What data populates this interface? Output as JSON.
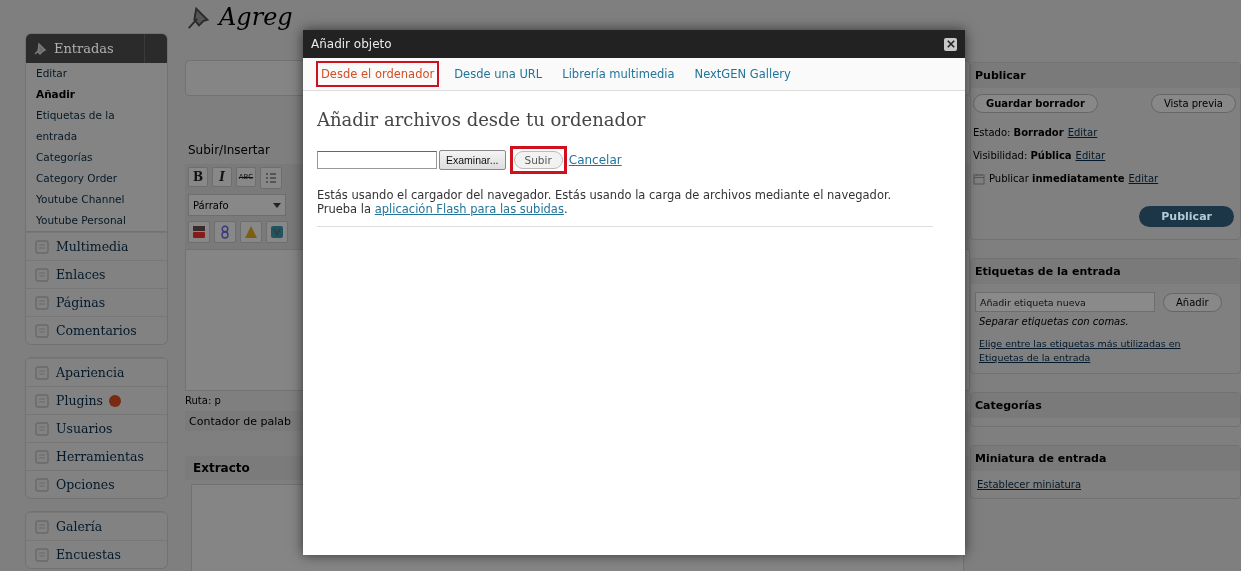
{
  "sidebar": {
    "groups": [
      [
        {
          "label": "Entradas",
          "expanded": true,
          "children": [
            {
              "label": "Editar",
              "selected": false
            },
            {
              "label": "Añadir",
              "selected": true
            },
            {
              "label": "Etiquetas de la entrada",
              "selected": false
            },
            {
              "label": "Categorías",
              "selected": false
            },
            {
              "label": "Category Order",
              "selected": false
            },
            {
              "label": "Youtube Channel",
              "selected": false
            },
            {
              "label": "Youtube Personal",
              "selected": false
            }
          ]
        },
        {
          "label": "Multimedia",
          "expanded": false
        },
        {
          "label": "Enlaces",
          "expanded": false
        },
        {
          "label": "Páginas",
          "expanded": false
        },
        {
          "label": "Comentarios",
          "expanded": false
        }
      ],
      [
        {
          "label": "Apariencia",
          "expanded": false
        },
        {
          "label": "Plugins",
          "expanded": false,
          "badge": true
        },
        {
          "label": "Usuarios",
          "expanded": false
        },
        {
          "label": "Herramientas",
          "expanded": false
        },
        {
          "label": "Opciones",
          "expanded": false
        }
      ],
      [
        {
          "label": "Galería",
          "expanded": false
        },
        {
          "label": "Encuestas",
          "expanded": false
        }
      ]
    ]
  },
  "editor": {
    "title": "Agreg",
    "upload_label": "Subir/Insertar",
    "toolbar": [
      "B",
      "I",
      "ABC"
    ],
    "format": "Párrafo",
    "path": "Ruta: p",
    "word_count": "Contador de palab",
    "excerpt_title": "Extracto"
  },
  "publish": {
    "title": "Publicar",
    "save_draft": "Guardar borrador",
    "preview": "Vista previa",
    "rows": [
      {
        "kind": "plain",
        "text": "Estado: **Borrador**",
        "link": "Editar"
      },
      {
        "kind": "plain",
        "text": "Visibilidad: **Pública**",
        "link": "Editar"
      },
      {
        "kind": "date",
        "text": "Publicar **inmediatamente**",
        "link": "Editar"
      }
    ],
    "publish_button": "Publicar"
  },
  "tags": {
    "title": "Etiquetas de la entrada",
    "placeholder": "Añadir etiqueta nueva",
    "add_button": "Añadir",
    "hint": "Separar etiquetas con comas.",
    "link": "Elige entre las etiquetas más utilizadas en Etiquetas de la entrada"
  },
  "categories": {
    "title": "Categorías"
  },
  "thumbnail": {
    "title": "Miniatura de entrada",
    "link": "Establecer miniatura"
  },
  "dialog": {
    "title": "Añadir objeto",
    "tabs": [
      {
        "label": "Desde el ordenador",
        "selected": true,
        "highlighted": true
      },
      {
        "label": "Desde una URL",
        "selected": false,
        "highlighted": false
      },
      {
        "label": "Librería multimedia",
        "selected": false,
        "highlighted": false
      },
      {
        "label": "NextGEN Gallery",
        "selected": false,
        "highlighted": false
      }
    ],
    "heading": "Añadir archivos desde tu ordenador",
    "browse_button": "Examinar...",
    "upload_button": {
      "label": "Subir",
      "highlighted": true
    },
    "cancel_link": "Cancelar",
    "notice": "Estás usando el cargador del navegador. Estás usando la carga de archivos mediante el navegador. Prueba la",
    "notice_link": "aplicación Flash para las subidas",
    "notice_end": "."
  }
}
